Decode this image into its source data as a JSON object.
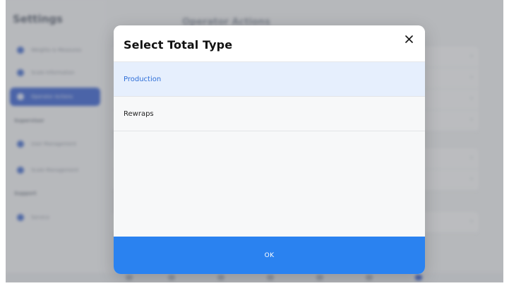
{
  "background": {
    "sidebar_title": "Settings",
    "header_title": "Operator Actions",
    "sidebar_items": [
      {
        "label": "Weights & Measures"
      },
      {
        "label": "Scale Information"
      },
      {
        "label": "Operator Actions"
      },
      {
        "label": "User Management"
      },
      {
        "label": "Scale Management"
      },
      {
        "label": "Service"
      }
    ],
    "sections": [
      "Supervisor",
      "Support"
    ]
  },
  "modal": {
    "title": "Select Total Type",
    "close_symbol": "✕",
    "options": [
      {
        "label": "Production",
        "selected": true
      },
      {
        "label": "Rewraps",
        "selected": false
      }
    ],
    "ok_label": "OK"
  },
  "colors": {
    "accent": "#2a82f0",
    "selected_bg": "#e6effd",
    "selected_text": "#2f6fd8"
  }
}
